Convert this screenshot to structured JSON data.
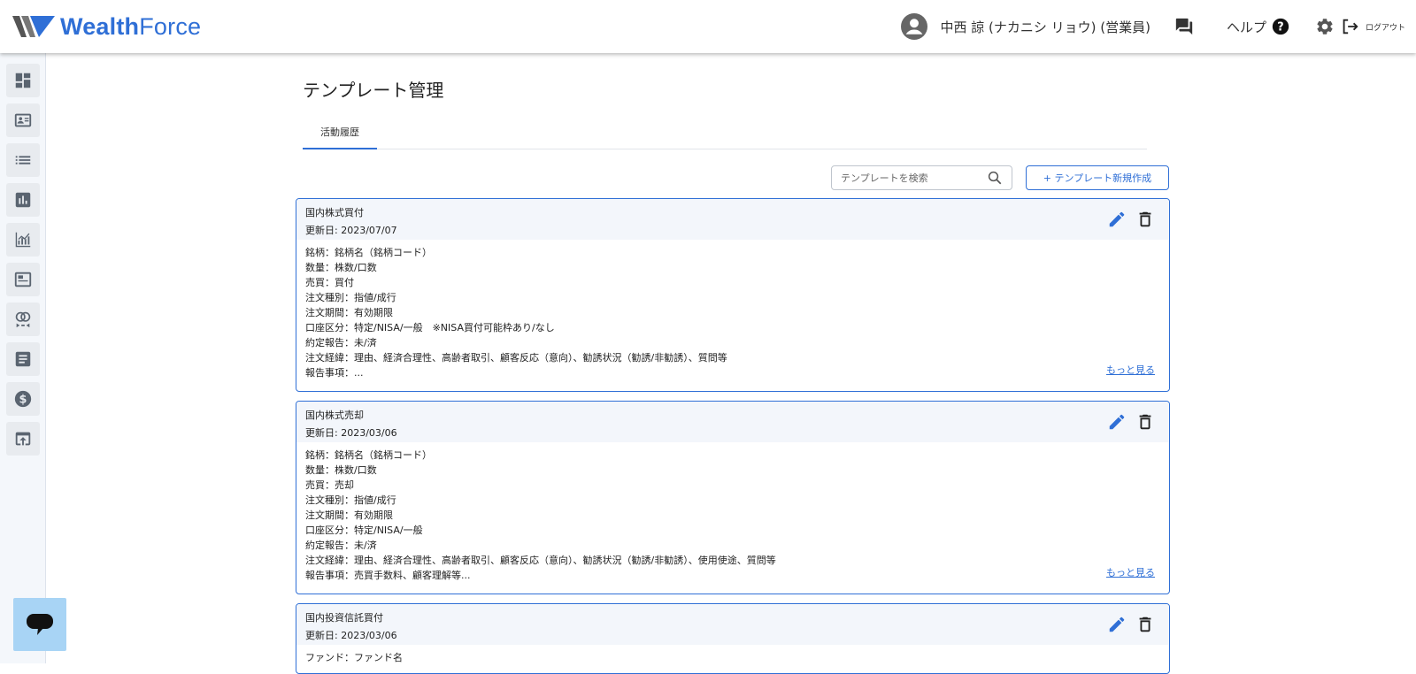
{
  "header": {
    "brand_light": "Wealth",
    "brand_regular": "Force",
    "user_name": "中西 諒 (ナカニシ リョウ) (営業員)",
    "help_label": "ヘルプ",
    "logout_label": "ログアウト",
    "icons": [
      "account-circle-icon",
      "chat-icon",
      "help-icon",
      "settings-icon",
      "logout-icon"
    ]
  },
  "sidebar": {
    "items": [
      {
        "icon": "dashboard-icon"
      },
      {
        "icon": "contact-card-icon"
      },
      {
        "icon": "list-icon"
      },
      {
        "icon": "bar-chart-icon"
      },
      {
        "icon": "analytics-icon"
      },
      {
        "icon": "document-icon"
      },
      {
        "icon": "relationship-icon"
      },
      {
        "icon": "article-icon"
      },
      {
        "icon": "dollar-icon"
      },
      {
        "icon": "upload-icon"
      }
    ]
  },
  "main": {
    "page_title": "テンプレート管理",
    "tabs": [
      {
        "label": "活動履歴",
        "active": true
      }
    ],
    "search": {
      "placeholder": "テンプレートを検索"
    },
    "new_button_label": "+ テンプレート新規作成",
    "more_label": "もっと見る",
    "cards": [
      {
        "title": "国内株式買付",
        "date": "更新日: 2023/07/07",
        "lines": [
          "銘柄：銘柄名（銘柄コード）",
          "数量：株数/口数",
          "売買：買付",
          "注文種別：指値/成行",
          "注文期間：有効期限",
          "口座区分：特定/NISA/一般　※NISA買付可能枠あり/なし",
          "約定報告：未/済",
          "注文経緯：理由、経済合理性、高齢者取引、顧客反応（意向）、勧誘状況（勧誘/非勧誘）、質問等",
          "報告事項：..."
        ]
      },
      {
        "title": "国内株式売却",
        "date": "更新日: 2023/03/06",
        "lines": [
          "銘柄：銘柄名（銘柄コード）",
          "数量：株数/口数",
          "売買：売却",
          "注文種別：指値/成行",
          "注文期間：有効期限",
          "口座区分：特定/NISA/一般",
          "約定報告：未/済",
          "注文経緯：理由、経済合理性、高齢者取引、顧客反応（意向）、勧誘状況（勧誘/非勧誘）、使用使途、質問等",
          "報告事項：売買手数料、顧客理解等..."
        ]
      },
      {
        "title": "国内投資信託買付",
        "date": "更新日: 2023/03/06",
        "lines": [
          "ファンド：ファンド名"
        ]
      }
    ]
  },
  "colors": {
    "accent": "#2f6fd6",
    "card_head": "#f3f6fb",
    "fab": "#a8d4f5"
  }
}
